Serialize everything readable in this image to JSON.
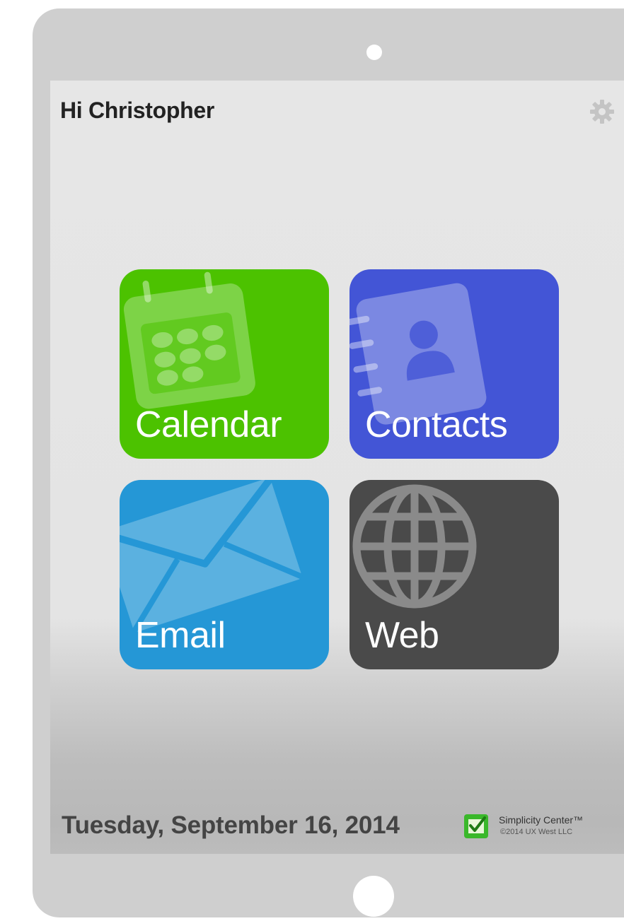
{
  "header": {
    "greeting": "Hi Christopher",
    "settings_icon": "gear-icon"
  },
  "tiles": [
    {
      "label": "Calendar",
      "icon": "calendar-icon",
      "color": "#4cc200"
    },
    {
      "label": "Contacts",
      "icon": "contacts-book-icon",
      "color": "#4355d6"
    },
    {
      "label": "Email",
      "icon": "envelope-icon",
      "color": "#2597d6"
    },
    {
      "label": "Web",
      "icon": "globe-icon",
      "color": "#4a4a4a"
    }
  ],
  "footer": {
    "date": "Tuesday, September 16, 2014",
    "brand_name": "Simplicity Center™",
    "brand_copyright": "©2014 UX West LLC",
    "brand_logo_icon": "checkbox-logo-icon"
  }
}
